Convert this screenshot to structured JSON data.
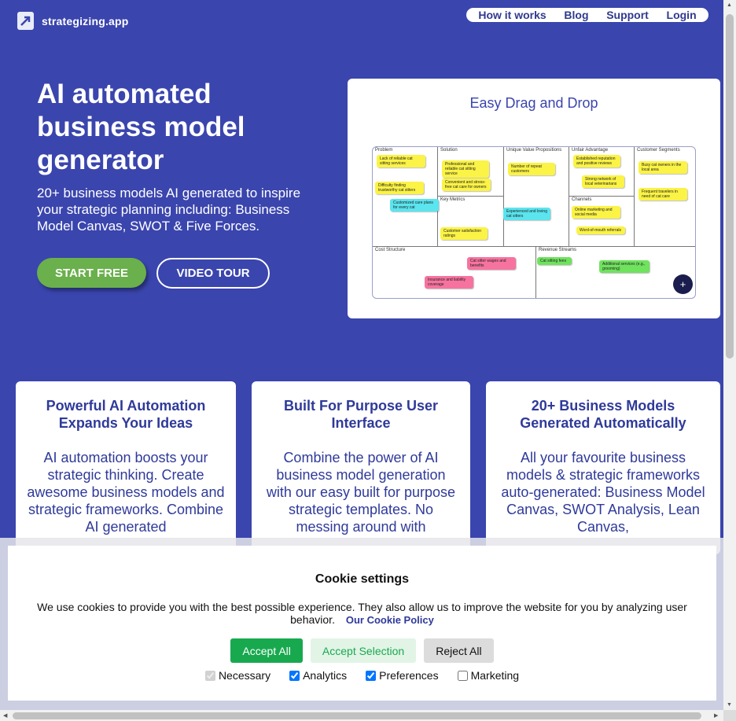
{
  "header": {
    "brand": "strategizing.app",
    "nav": [
      "How it works",
      "Blog",
      "Support",
      "Login"
    ]
  },
  "hero": {
    "title": "AI automated business model generator",
    "subtitle": "20+ business models AI generated to inspire your strategic planning including: Business Model Canvas, SWOT & Five Forces.",
    "start_label": "START FREE",
    "video_label": "VIDEO TOUR"
  },
  "demo": {
    "title": "Easy Drag and Drop",
    "sections": {
      "problem": "Problem",
      "solution": "Solution",
      "uvp": "Unique Value Propositions",
      "unfair": "Unfair Advantage",
      "segments": "Customer Segments",
      "metrics": "Key Metrics",
      "channels": "Channels",
      "cost": "Cost Structure",
      "revenue": "Revenue Streams"
    },
    "notes": {
      "n1": "Lack of reliable cat sitting services",
      "n2": "Difficulty finding trustworthy cat sitters",
      "n3": "Customized care plans for every cat",
      "n4": "Professional and reliable cat sitting service",
      "n5": "Convenient and stress-free cat care for owners",
      "n6": "Customer satisfaction ratings",
      "n7": "Number of repeat customers",
      "n8": "Experienced and loving cat sitters",
      "n9": "Established reputation and positive reviews",
      "n10": "Strong network of local veterinarians",
      "n11": "Online marketing and social media",
      "n12": "Word-of-mouth referrals",
      "n13": "Busy cat owners in the local area",
      "n14": "Frequent travelers in need of cat care",
      "n15": "Cat sitter wages and benefits",
      "n16": "Insurance and liability coverage",
      "n17": "Cat sitting fees",
      "n18": "Additional services (e.g., grooming)"
    },
    "plus": "+"
  },
  "features": [
    {
      "title": "Powerful AI Automation Expands Your Ideas",
      "body": "AI automation boosts your strategic thinking. Create awesome business models and strategic frameworks. Combine AI generated"
    },
    {
      "title": "Built For Purpose User Interface",
      "body": "Combine the power of AI business model generation with our easy built for purpose strategic templates. No messing around with"
    },
    {
      "title": "20+ Business Models Generated Automatically",
      "body": "All your favourite business models & strategic frameworks auto-generated: Business Model Canvas, SWOT Analysis, Lean Canvas,"
    }
  ],
  "cookie": {
    "title": "Cookie settings",
    "message": "We use cookies to provide you with the best possible experience. They also allow us to improve the website for you by analyzing user behavior.",
    "policy_link": "Our Cookie Policy",
    "accept_all": "Accept All",
    "accept_selection": "Accept Selection",
    "reject_all": "Reject All",
    "checks": {
      "necessary": "Necessary",
      "analytics": "Analytics",
      "preferences": "Preferences",
      "marketing": "Marketing"
    }
  }
}
